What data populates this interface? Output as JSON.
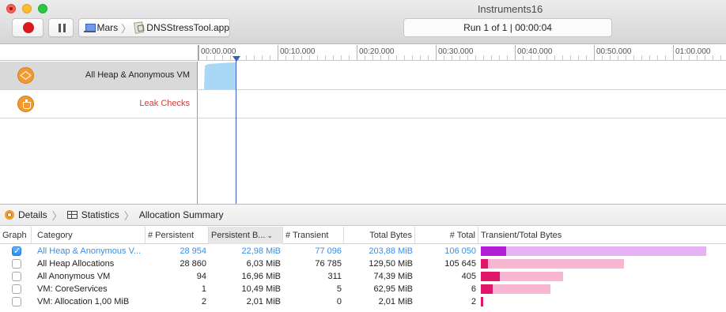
{
  "window": {
    "title": "Instruments16"
  },
  "toolbar": {
    "target_device": "Mars",
    "target_app": "DNSStressTool.app",
    "run_status": "Run 1 of 1  |  00:00:04"
  },
  "ruler": {
    "ticks": [
      "00:00.000",
      "00:10.000",
      "00:20.000",
      "00:30.000",
      "00:40.000",
      "00:50.000",
      "01:00.000"
    ]
  },
  "tracks": [
    {
      "label": "All Heap & Anonymous VM",
      "icon": "allocations-icon"
    },
    {
      "label": "Leak Checks",
      "icon": "leaks-icon"
    }
  ],
  "details": {
    "crumbs": [
      "Details",
      "Statistics",
      "Allocation Summary"
    ]
  },
  "table": {
    "columns": [
      "Graph",
      "Category",
      "# Persistent",
      "Persistent B...",
      "# Transient",
      "Total Bytes",
      "# Total",
      "Transient/Total Bytes"
    ],
    "rows": [
      {
        "checked": true,
        "category": "All Heap & Anonymous V...",
        "persistent": "28 954",
        "persistent_bytes": "22,98 MiB",
        "transient": "77 096",
        "total_bytes": "203,88 MiB",
        "total": "106 050",
        "bar_total": 1.0,
        "bar_persistent": 0.113
      },
      {
        "checked": false,
        "category": "All Heap Allocations",
        "persistent": "28 860",
        "persistent_bytes": "6,03 MiB",
        "transient": "76 785",
        "total_bytes": "129,50 MiB",
        "total": "105 645",
        "bar_total": 0.635,
        "bar_persistent": 0.03
      },
      {
        "checked": false,
        "category": "All Anonymous VM",
        "persistent": "94",
        "persistent_bytes": "16,96 MiB",
        "transient": "311",
        "total_bytes": "74,39 MiB",
        "total": "405",
        "bar_total": 0.365,
        "bar_persistent": 0.083
      },
      {
        "checked": false,
        "category": "VM: CoreServices",
        "persistent": "1",
        "persistent_bytes": "10,49 MiB",
        "transient": "5",
        "total_bytes": "62,95 MiB",
        "total": "6",
        "bar_total": 0.309,
        "bar_persistent": 0.051
      },
      {
        "checked": false,
        "category": "VM: Allocation 1,00 MiB",
        "persistent": "2",
        "persistent_bytes": "2,01 MiB",
        "transient": "0",
        "total_bytes": "2,01 MiB",
        "total": "2",
        "bar_total": 0.01,
        "bar_persistent": 0.01
      }
    ]
  },
  "colors": {
    "accent": "#3a8ee6",
    "playhead": "#3b5fb9",
    "heap_graph": "#a9d8f7",
    "leak_label": "#d33b3b",
    "bar_purple_light": "#e6b3f2",
    "bar_purple_dark": "#b01fd6",
    "bar_pink_light": "#f7b6d2",
    "bar_pink_dark": "#e0166a"
  }
}
